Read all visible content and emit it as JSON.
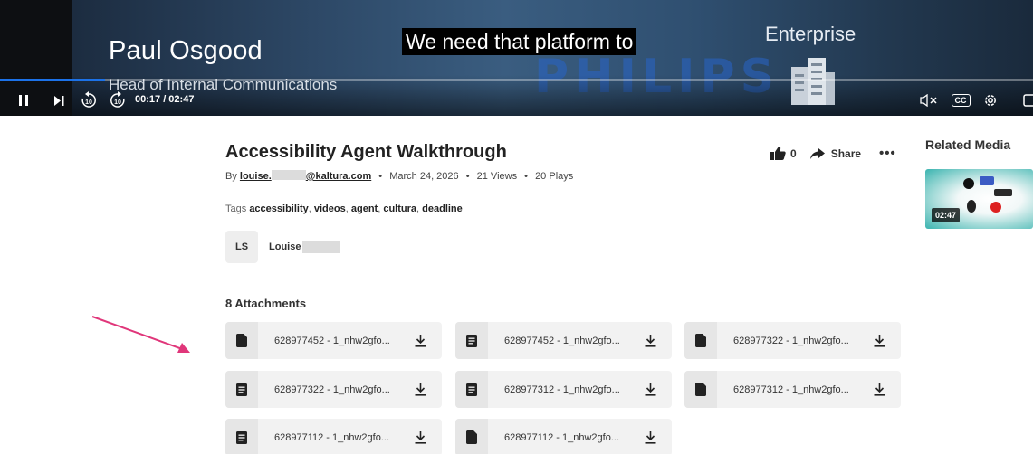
{
  "player": {
    "lower_third_name": "Paul Osgood",
    "lower_third_title": "Head of Internal Communications",
    "caption": "We need that platform to",
    "watermark": "PHILIPS",
    "corner_label": "Enterprise",
    "time_display": "00:17 / 02:47",
    "skip_back_label": "10",
    "skip_forward_label": "10",
    "progress_fraction": 0.102,
    "volume_muted_icon": "volume-muted-icon",
    "cc_label": "CC"
  },
  "media": {
    "title": "Accessibility Agent Walkthrough",
    "by_label": "By",
    "owner_email_prefix": "louise.",
    "owner_email_suffix": "@kaltura.com",
    "date": "March 24, 2026",
    "views": "21 Views",
    "plays": "20 Plays",
    "tags_label": "Tags",
    "tags": [
      "accessibility",
      "videos",
      "agent",
      "cultura",
      "deadline"
    ],
    "like_count": "0",
    "share_label": "Share",
    "more_label": "•••",
    "owner_initials": "LS",
    "owner_first_name": "Louise"
  },
  "attachments": {
    "heading": "8 Attachments",
    "items": [
      {
        "name": "628977452 - 1_nhw2gfo...",
        "icon": "file-icon"
      },
      {
        "name": "628977452 - 1_nhw2gfo...",
        "icon": "document-icon"
      },
      {
        "name": "628977322 - 1_nhw2gfo...",
        "icon": "file-icon"
      },
      {
        "name": "628977322 - 1_nhw2gfo...",
        "icon": "document-icon"
      },
      {
        "name": "628977312 - 1_nhw2gfo...",
        "icon": "document-icon"
      },
      {
        "name": "628977312 - 1_nhw2gfo...",
        "icon": "file-icon"
      },
      {
        "name": "628977112 - 1_nhw2gfo...",
        "icon": "document-icon"
      },
      {
        "name": "628977112 - 1_nhw2gfo...",
        "icon": "file-icon"
      }
    ]
  },
  "related": {
    "heading": "Related Media",
    "items": [
      {
        "duration": "02:47"
      }
    ]
  },
  "colors": {
    "progress": "#1c72e8",
    "annotation_arrow": "#e0367a",
    "tile_bg": "#f2f2f2"
  }
}
